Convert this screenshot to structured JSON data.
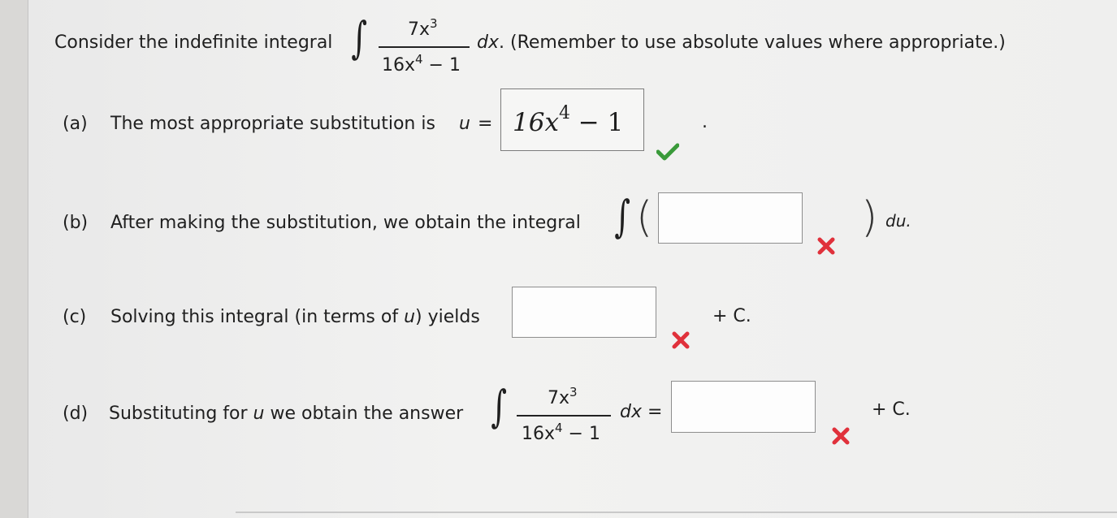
{
  "question": {
    "intro_prefix": "Consider the indefinite integral",
    "integral_num_coef": "7x",
    "integral_num_exp": "3",
    "integral_den_pre": "16x",
    "integral_den_exp": "4",
    "integral_den_post": " − 1",
    "dx": "dx",
    "intro_suffix": ". (Remember to use absolute values where appropriate.)"
  },
  "part_a": {
    "label": "(a)",
    "text": "The most appropriate substitution is",
    "var": "u",
    "equals": "=",
    "answer_pre": "16x",
    "answer_exp": "4",
    "answer_post": " − 1",
    "trailing": ".",
    "status": "correct"
  },
  "part_b": {
    "label": "(b)",
    "text": "After making the substitution, we obtain the integral",
    "du": "du.",
    "status": "incorrect",
    "value": ""
  },
  "part_c": {
    "label": "(c)",
    "text_pre": "Solving this integral (in terms of",
    "var": "u",
    "text_post": ") yields",
    "plus_c": "+ C.",
    "status": "incorrect",
    "value": ""
  },
  "part_d": {
    "label": "(d)",
    "text_pre": "Substituting for",
    "var": "u",
    "text_post": "we obtain the answer",
    "dx_eq": "dx =",
    "plus_c": "+ C.",
    "status": "incorrect",
    "value": ""
  },
  "colors": {
    "correct": "#3a9a3a",
    "incorrect": "#e0313b"
  },
  "icons": {
    "correct": "checkmark-icon",
    "incorrect": "x-mark-icon"
  }
}
